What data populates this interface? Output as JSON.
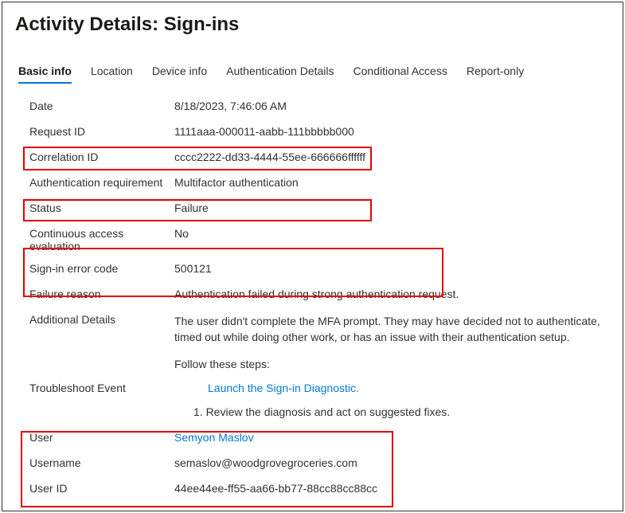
{
  "title": "Activity Details: Sign-ins",
  "tabs": [
    {
      "label": "Basic info",
      "active": true
    },
    {
      "label": "Location",
      "active": false
    },
    {
      "label": "Device info",
      "active": false
    },
    {
      "label": "Authentication Details",
      "active": false
    },
    {
      "label": "Conditional Access",
      "active": false
    },
    {
      "label": "Report-only",
      "active": false
    }
  ],
  "rows": {
    "date": {
      "label": "Date",
      "value": "8/18/2023, 7:46:06 AM"
    },
    "requestId": {
      "label": "Request ID",
      "value": "1111aaa-000011-aabb-111bbbbb000"
    },
    "correlationId": {
      "label": "Correlation ID",
      "value": "cccc2222-dd33-4444-55ee-666666ffffff"
    },
    "authRequirement": {
      "label": "Authentication requirement",
      "value": "Multifactor authentication"
    },
    "status": {
      "label": "Status",
      "value": "Failure"
    },
    "cae": {
      "label": "Continuous access evaluation",
      "value": "No"
    },
    "errorCode": {
      "label": "Sign-in error code",
      "value": "500121"
    },
    "failureReason": {
      "label": "Failure reason",
      "value": "Authentication failed during strong authentication request."
    },
    "additionalDetails": {
      "label": "Additional Details",
      "value": "The user didn't complete the MFA prompt. They may have decided not to authenticate, timed out while doing other work, or has an issue with their authentication setup."
    },
    "troubleshoot": {
      "label": "Troubleshoot Event",
      "intro": "Follow these steps:",
      "link": "Launch the Sign-in Diagnostic.",
      "step1": "1. Review the diagnosis and act on suggested fixes."
    },
    "user": {
      "label": "User",
      "value": "Semyon Maslov"
    },
    "username": {
      "label": "Username",
      "value": "semaslov@woodgrovegroceries.com"
    },
    "userId": {
      "label": "User ID",
      "value": "44ee44ee-ff55-aa66-bb77-88cc88cc88cc"
    }
  }
}
